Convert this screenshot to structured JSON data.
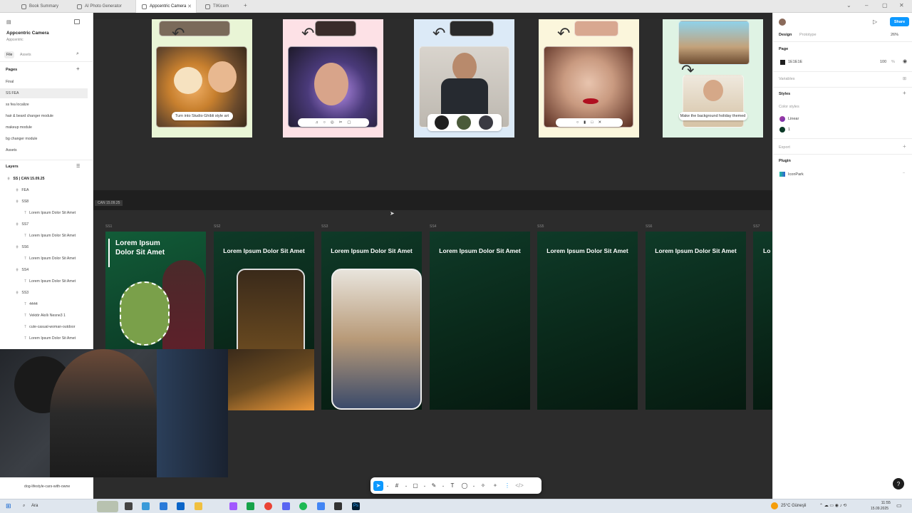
{
  "tabs": [
    {
      "label": "Book Summary"
    },
    {
      "label": "AI Photo Generator"
    },
    {
      "label": "Appcentric Camera"
    },
    {
      "label": "TIKicem"
    }
  ],
  "left_panel": {
    "file_name": "Appcentric Camera",
    "team": "Appcentric",
    "tab_file": "File",
    "tab_assets": "Assets",
    "pages_header": "Pages",
    "pages": [
      "Final",
      "SS FEA",
      "ss fea localize",
      "hair & beard changer module",
      "makeup module",
      "bg changer module",
      "Assets"
    ],
    "layers_header": "Layers",
    "layers": [
      {
        "label": "SS | CAN 15.09.25",
        "indent": 0
      },
      {
        "label": "FEA",
        "indent": 1
      },
      {
        "label": "SS8",
        "indent": 1
      },
      {
        "label": "Lorem Ipsum Dolor Sit Amet",
        "indent": 2
      },
      {
        "label": "SS7",
        "indent": 1
      },
      {
        "label": "Lorem Ipsum Dolor Sit Amet",
        "indent": 2
      },
      {
        "label": "SS6",
        "indent": 1
      },
      {
        "label": "Lorem Ipsum Dolor Sit Amet",
        "indent": 2
      },
      {
        "label": "SS4",
        "indent": 1
      },
      {
        "label": "Lorem Ipsum Dolor Sit Amet",
        "indent": 2
      },
      {
        "label": "SS3",
        "indent": 1
      },
      {
        "label": "4444",
        "indent": 2
      },
      {
        "label": "Vektör Akıllı Nesne3 1",
        "indent": 2
      },
      {
        "label": "cute-casual-woman-outdoor",
        "indent": 2
      },
      {
        "label": "Lorem Ipsum Dolor Sit Amet",
        "indent": 2
      }
    ],
    "bottom_layer": "dog-lifestyle-cars-with-owne"
  },
  "canvas": {
    "strip_label": "CAN 15.09.25",
    "top_frames": [
      {
        "pill": "Turn into Studio Ghibli style art",
        "colors": [
          "#e9f5d6",
          "#f0b38b",
          "#8b5a2b"
        ]
      },
      {
        "icons": [
          "♫",
          "○",
          "◎",
          "✂",
          "▢"
        ],
        "colors": [
          "#fde1e6",
          "#3a2c2a",
          "#9b6dd4"
        ]
      },
      {
        "icons": [],
        "colors": [
          "#dceaf7",
          "#c8c6c2",
          "#2a2a2a"
        ]
      },
      {
        "icons": [
          "○",
          "▮",
          "□",
          "✕"
        ],
        "colors": [
          "#fbf6dc",
          "#d8b8a8",
          "#7a3a2a"
        ]
      },
      {
        "pill": "Make the background holiday themed",
        "colors": [
          "#dff3e4",
          "#7a5a3a",
          "#c9b79c"
        ]
      }
    ],
    "ss_labels": [
      "SS1",
      "SS2",
      "SS3",
      "SS4",
      "SS5",
      "SS6",
      "SS7"
    ],
    "ss1_title": "Lorem Ipsum Dolor Sit Amet",
    "ss_title": "Lorem Ipsum Dolor Sit Amet",
    "ss_last_partial": "Lo"
  },
  "right_panel": {
    "tab_design": "Design",
    "tab_prototype": "Prototype",
    "zoom": "26%",
    "share": "Share",
    "page_section": "Page",
    "page_color": "1E1E1E",
    "page_opacity": "100",
    "page_opacity_unit": "%",
    "variables": "Variables",
    "styles": "Styles",
    "color_styles": "Color styles",
    "color_style_1": "Linear",
    "color_style_2": "1",
    "export": "Export",
    "plugin": "Plugin",
    "plugin_name": "IconPark",
    "accent": "#0d99ff"
  },
  "taskbar": {
    "search": "Ara",
    "weather": "25°C Güneşli",
    "time": "11:55",
    "date": "15.09.2025"
  }
}
